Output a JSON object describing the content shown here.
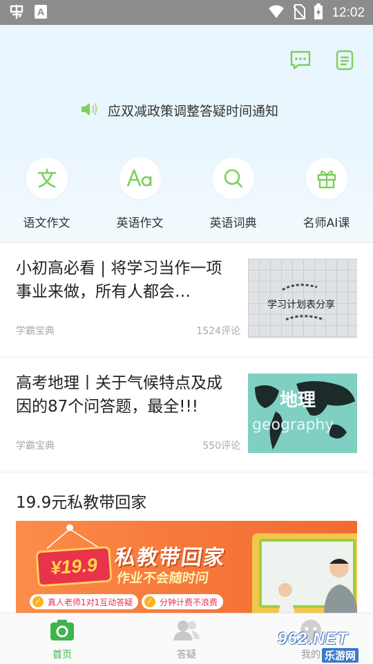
{
  "status_bar": {
    "time": "12:02",
    "app_badge": "A"
  },
  "header": {
    "notice": "应双减政策调整答疑时间通知"
  },
  "features": [
    {
      "label": "语文作文",
      "icon": "wen-icon"
    },
    {
      "label": "英语作文",
      "icon": "aa-icon"
    },
    {
      "label": "英语词典",
      "icon": "search-icon"
    },
    {
      "label": "名师AI课",
      "icon": "gift-icon"
    }
  ],
  "articles": [
    {
      "title": "小初高必看 | 将学习当作一项事业来做，所有人都会…",
      "source": "学霸宝典",
      "comments": "1524评论",
      "thumb_text": "学习计划表分享"
    },
    {
      "title": "高考地理丨关于气候特点及成因的87个问答题，最全!!!",
      "source": "学霸宝典",
      "comments": "550评论",
      "thumb_text_1": "地理",
      "thumb_text_2": "geography"
    }
  ],
  "promo": {
    "title": "19.9元私教带回家",
    "price": "¥19.9",
    "headline": "私教带回家",
    "subheadline": "作业不会随时问",
    "tag1": "真人老师1对1互动答疑",
    "tag2": "分钟计费不浪费"
  },
  "tabs": [
    {
      "label": "首页",
      "icon": "camera-icon",
      "active": true
    },
    {
      "label": "答疑",
      "icon": "users-icon",
      "active": false
    },
    {
      "label": "我的",
      "icon": "profile-icon",
      "active": false
    }
  ],
  "watermark": {
    "line1": "962.NET",
    "line2": "乐游网"
  },
  "colors": {
    "accent": "#7ccf5c",
    "tab_active": "#3fb44c",
    "tab_inactive": "#999999",
    "header_bg": "#eaf6fd"
  }
}
